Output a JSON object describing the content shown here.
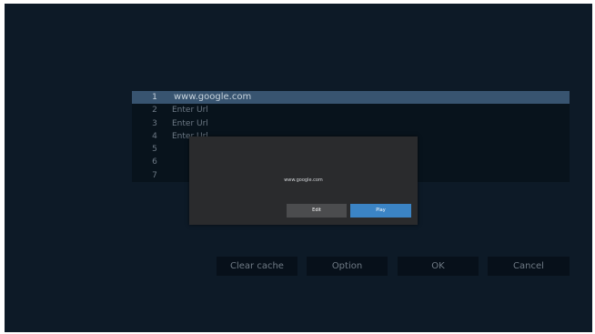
{
  "url_list": {
    "rows": [
      {
        "num": "1",
        "url": "www.google.com",
        "selected": true
      },
      {
        "num": "2",
        "url": "Enter Url"
      },
      {
        "num": "3",
        "url": "Enter Url"
      },
      {
        "num": "4",
        "url": "Enter Url"
      },
      {
        "num": "5",
        "url": ""
      },
      {
        "num": "6",
        "url": ""
      },
      {
        "num": "7",
        "url": ""
      }
    ]
  },
  "dialog": {
    "message": "www.google.com",
    "edit_label": "Edit",
    "play_label": "Play"
  },
  "actions": {
    "clear_cache_label": "Clear cache",
    "option_label": "Option",
    "ok_label": "OK",
    "cancel_label": "Cancel"
  },
  "colors": {
    "screen_bg": "#0d1a27",
    "selected_row": "#385470",
    "play_accent": "#3b84c5"
  }
}
